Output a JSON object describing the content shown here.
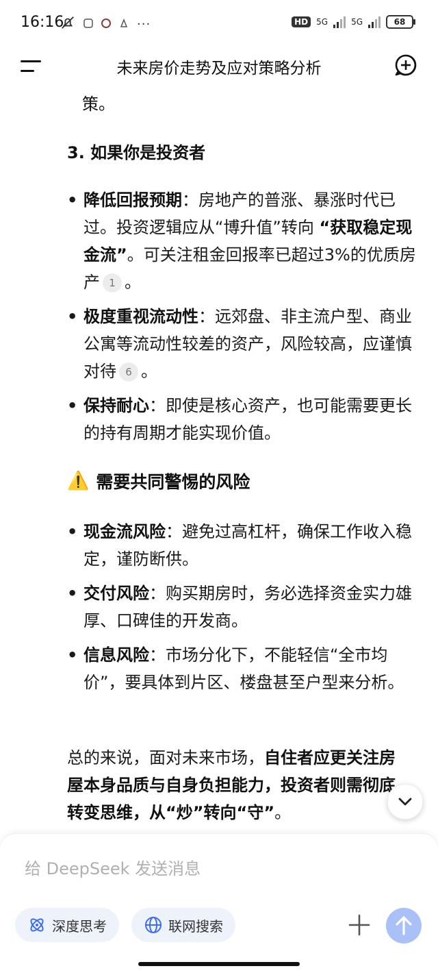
{
  "status": {
    "time": "16:16",
    "hd_label": "HD",
    "network1": "5G",
    "network2": "5G",
    "battery": "68",
    "more": "···"
  },
  "header": {
    "title": "未来房价走势及应对策略分析"
  },
  "content": {
    "cont_text": "策。",
    "section3_heading": "3. 如果你是投资者",
    "investor_items": [
      {
        "bold": "降低回报预期",
        "text_a": "：房地产的普涨、暴涨时代已过。投资逻辑应从“博升值”转向 ",
        "bold2": "“获取稳定现金流”",
        "text_b": "。可关注租金回报率已超过3%的优质房产",
        "cite": "1",
        "tail": "。"
      },
      {
        "bold": "极度重视流动性",
        "text_a": "：远郊盘、非主流户型、商业公寓等流动性较差的资产，风险较高，应谨慎对待",
        "cite": "6",
        "tail": "。"
      },
      {
        "bold": "保持耐心",
        "text_a": "：即使是核心资产，也可能需要更长的持有周期才能实现价值。"
      }
    ],
    "risk_heading": "需要共同警惕的风险",
    "risk_icon": "⚠️",
    "risk_items": [
      {
        "bold": "现金流风险",
        "text": "：避免过高杠杆，确保工作收入稳定，谨防断供。"
      },
      {
        "bold": "交付风险",
        "text": "：购买期房时，务必选择资金实力雄厚、口碑佳的开发商。"
      },
      {
        "bold": "信息风险",
        "text": "：市场分化下，不能轻信“全市均价”，要具体到片区、楼盘甚至户型来分析。"
      }
    ],
    "summary": {
      "text_a": "总的来说，面对未来市场，",
      "bold": "自住者应更关注房屋本身品质与自身负担能力，投资者则需彻底转变思维，从“炒”转向“守”",
      "tail": "。"
    }
  },
  "composer": {
    "placeholder": "给 DeepSeek 发送消息",
    "deep_think": "深度思考",
    "web_search": "联网搜索"
  },
  "colors": {
    "accent_light": "#eef3fb",
    "send_button": "#a9c1f7",
    "icon_blue": "#3d6cf0"
  }
}
